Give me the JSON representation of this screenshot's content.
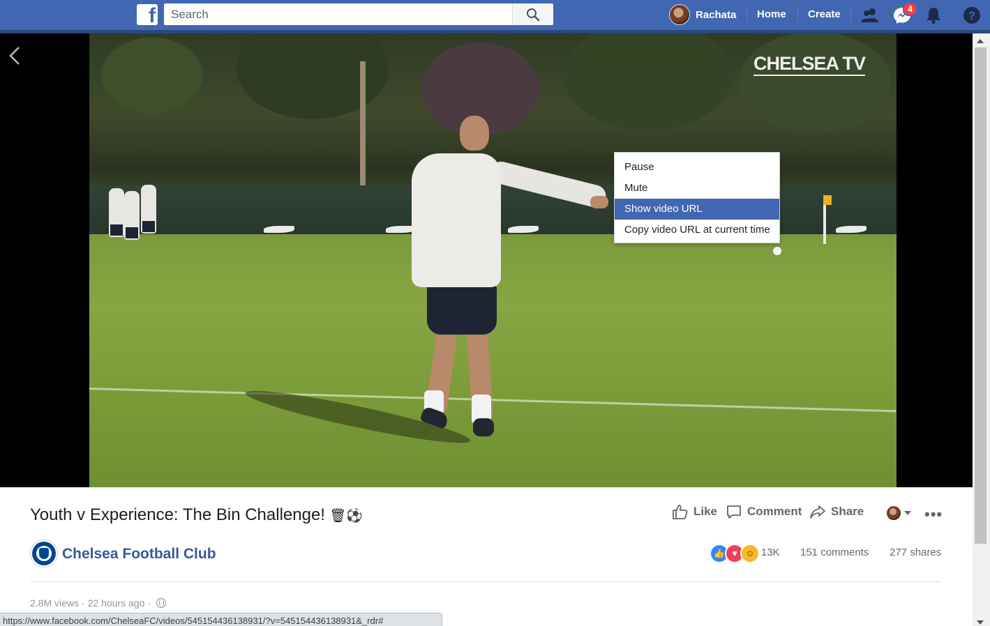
{
  "header": {
    "logo": "f",
    "search_placeholder": "Search",
    "profile_name": "Rachata",
    "nav_home": "Home",
    "nav_create": "Create",
    "messages_badge": "4",
    "icons": [
      "search-icon",
      "friends-icon",
      "messenger-icon",
      "notifications-icon",
      "help-icon"
    ],
    "colors": {
      "bar": "#4267b2",
      "badge": "#fa3e3e"
    }
  },
  "video": {
    "watermark": "CHELSEA TV",
    "context_menu": {
      "items": [
        "Pause",
        "Mute",
        "Show video URL",
        "Copy video URL at current time"
      ],
      "selected_index": 2,
      "selected_color": "#4267b2"
    }
  },
  "post": {
    "title": "Youth v Experience: The Bin Challenge!",
    "title_emoji": "🗑⚽",
    "page_name": "Chelsea Football Club",
    "actions": {
      "like": "Like",
      "comment": "Comment",
      "share": "Share"
    },
    "reactions_count": "13K",
    "comments": "151 comments",
    "shares": "277 shares",
    "views": "2.8M views",
    "time": "22 hours ago",
    "separator": "·"
  },
  "status_bar": {
    "url": "https://www.facebook.com/ChelseaFC/videos/545154436138931/?v=545154436138931&_rdr#"
  }
}
